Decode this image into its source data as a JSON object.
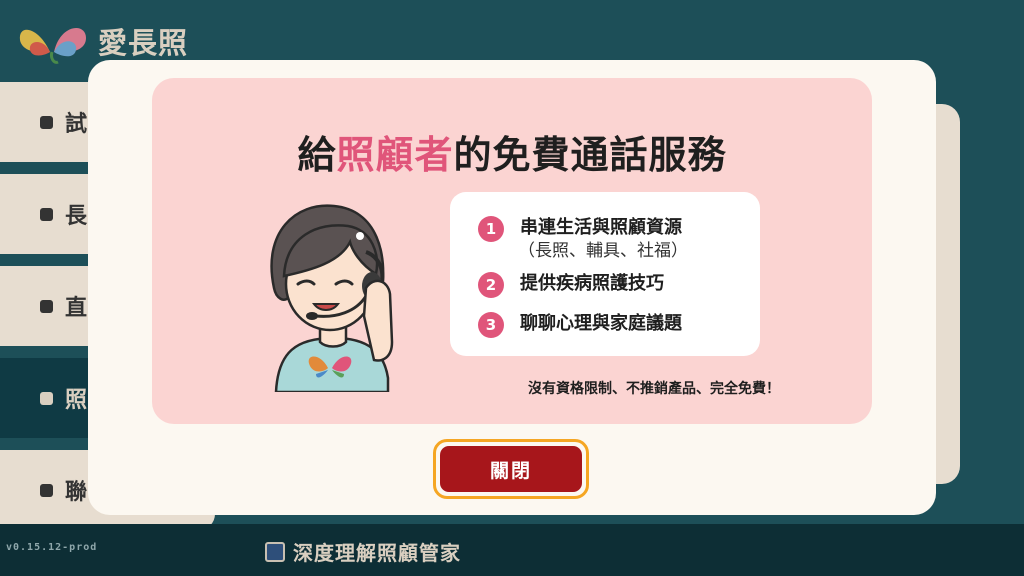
{
  "app": {
    "logo_text": "愛長照",
    "version": "v0.15.12-prod"
  },
  "menu": {
    "items": [
      {
        "label": "試"
      },
      {
        "label": "長"
      },
      {
        "label": "直"
      },
      {
        "label": "照"
      },
      {
        "label": "聯"
      }
    ]
  },
  "bottom": {
    "checkbox_label": "深度理解照顧管家"
  },
  "modal": {
    "title_before": "給",
    "title_highlight": "照顧者",
    "title_after": "的免費通話服務",
    "list": [
      {
        "num": "1",
        "text": "串連生活與照顧資源",
        "sub": "（長照、輔具、社福）"
      },
      {
        "num": "2",
        "text": "提供疾病照護技巧"
      },
      {
        "num": "3",
        "text": "聊聊心理與家庭議題"
      }
    ],
    "note": "沒有資格限制、不推銷產品、完全免費！",
    "close_label": "關閉"
  },
  "colors": {
    "accent": "#e0557a",
    "close_button": "#a7161b",
    "close_outline": "#f5a623",
    "card_bg": "#fbd4d2"
  },
  "icons": [
    "logo-butterfly-icon",
    "operator-illustration"
  ]
}
